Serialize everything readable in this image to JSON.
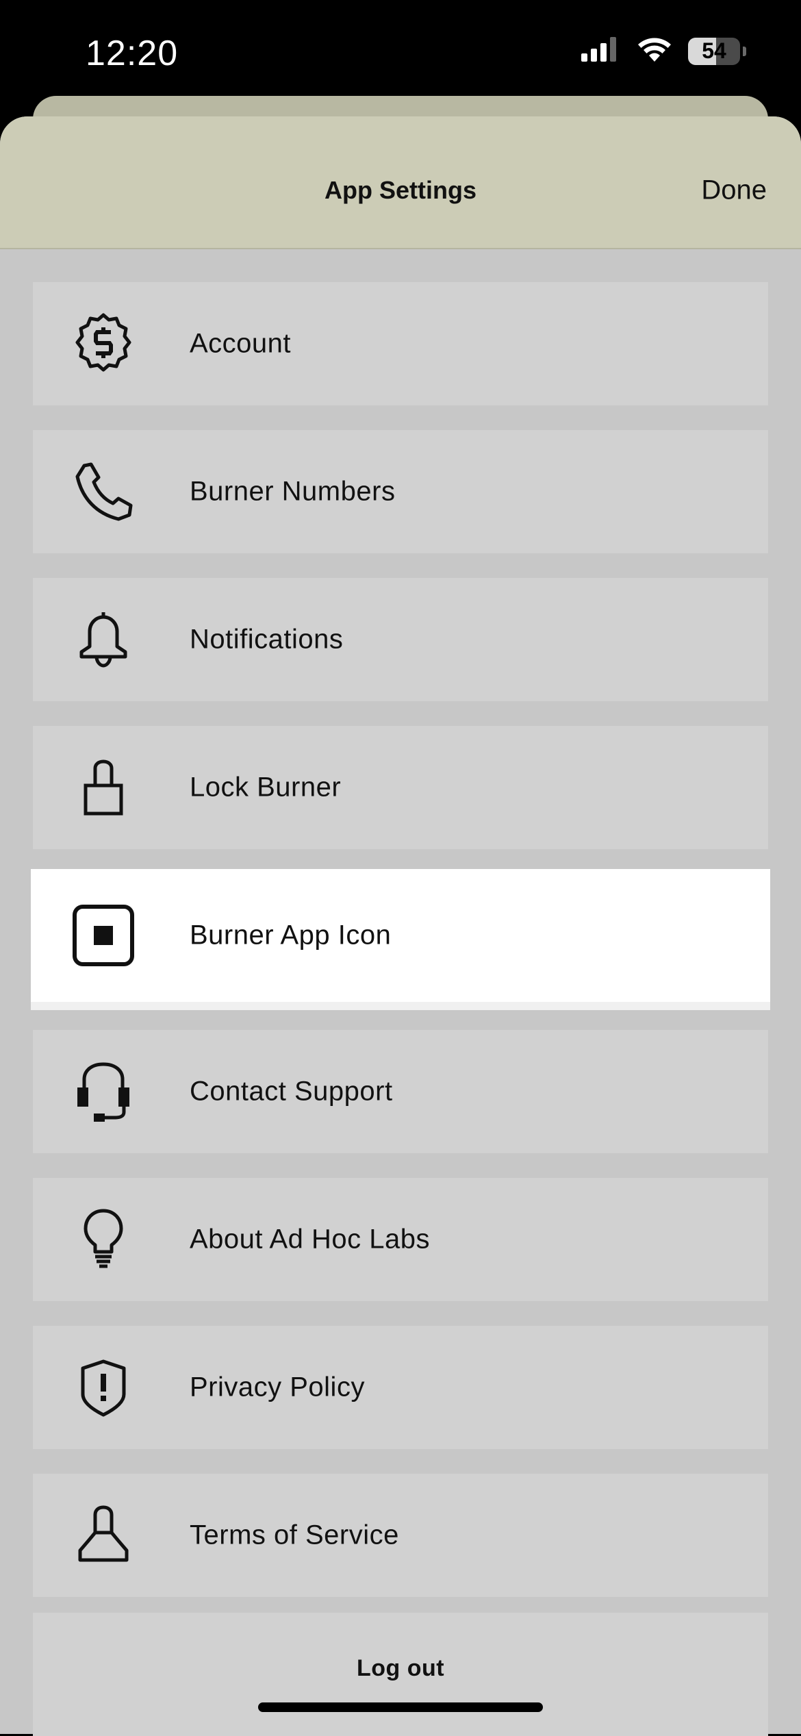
{
  "status_bar": {
    "time": "12:20",
    "battery_level": "54",
    "battery_fraction": 0.54,
    "icons": [
      "cellular-signal-icon",
      "wifi-icon",
      "battery-icon"
    ]
  },
  "sheet": {
    "title": "App Settings",
    "done_label": "Done"
  },
  "settings": {
    "items": [
      {
        "label": "Account",
        "icon": "dollar-badge-icon"
      },
      {
        "label": "Burner Numbers",
        "icon": "phone-icon"
      },
      {
        "label": "Notifications",
        "icon": "bell-icon"
      },
      {
        "label": "Lock Burner",
        "icon": "lock-icon"
      },
      {
        "label": "Burner App Icon",
        "icon": "app-icon-square-icon"
      },
      {
        "label": "Contact Support",
        "icon": "headset-icon"
      },
      {
        "label": "About Ad Hoc Labs",
        "icon": "lightbulb-icon"
      },
      {
        "label": "Privacy Policy",
        "icon": "shield-exclamation-icon"
      },
      {
        "label": "Terms of Service",
        "icon": "person-icon"
      }
    ],
    "highlighted_index": 4
  },
  "logout": {
    "label": "Log out"
  },
  "colors": {
    "header_bg": "#ccccb6",
    "sheet_bg": "#c7c7c7",
    "item_bg": "#d1d1d1",
    "highlight_bg": "#ffffff",
    "status_bar_bg": "#000000"
  }
}
